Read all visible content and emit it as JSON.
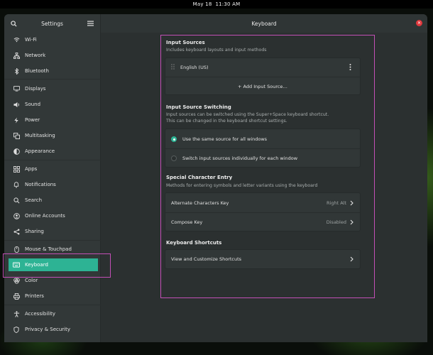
{
  "topbar": {
    "date": "May 18",
    "time": "11:30 AM"
  },
  "window": {
    "sidebar_title": "Settings",
    "title": "Keyboard"
  },
  "sidebar": {
    "items": [
      {
        "label": "Wi-Fi",
        "icon": "wifi-icon"
      },
      {
        "label": "Network",
        "icon": "network-icon"
      },
      {
        "label": "Bluetooth",
        "icon": "bluetooth-icon"
      },
      {
        "label": "Displays",
        "icon": "display-icon"
      },
      {
        "label": "Sound",
        "icon": "sound-icon"
      },
      {
        "label": "Power",
        "icon": "power-icon"
      },
      {
        "label": "Multitasking",
        "icon": "multitasking-icon"
      },
      {
        "label": "Appearance",
        "icon": "appearance-icon"
      },
      {
        "label": "Apps",
        "icon": "apps-icon"
      },
      {
        "label": "Notifications",
        "icon": "bell-icon"
      },
      {
        "label": "Search",
        "icon": "search-icon"
      },
      {
        "label": "Online Accounts",
        "icon": "online-accounts-icon"
      },
      {
        "label": "Sharing",
        "icon": "share-icon"
      },
      {
        "label": "Mouse & Touchpad",
        "icon": "mouse-icon"
      },
      {
        "label": "Keyboard",
        "icon": "keyboard-icon",
        "active": true
      },
      {
        "label": "Color",
        "icon": "color-icon"
      },
      {
        "label": "Printers",
        "icon": "printer-icon"
      },
      {
        "label": "Accessibility",
        "icon": "accessibility-icon"
      },
      {
        "label": "Privacy & Security",
        "icon": "privacy-icon"
      }
    ]
  },
  "input_sources": {
    "title": "Input Sources",
    "subtitle": "Includes keyboard layouts and input methods",
    "sources": [
      "English (US)"
    ],
    "add_label": "+ Add Input Source…"
  },
  "switching": {
    "title": "Input Source Switching",
    "subtitle_1": "Input sources can be switched using the Super+Space keyboard shortcut.",
    "subtitle_2": "This can be changed in the keyboard shortcut settings.",
    "options": [
      {
        "label": "Use the same source for all windows",
        "selected": true
      },
      {
        "label": "Switch input sources individually for each window",
        "selected": false
      }
    ]
  },
  "special_chars": {
    "title": "Special Character Entry",
    "subtitle": "Methods for entering symbols and letter variants using the keyboard",
    "rows": [
      {
        "label": "Alternate Characters Key",
        "value": "Right Alt"
      },
      {
        "label": "Compose Key",
        "value": "Disabled"
      }
    ]
  },
  "shortcuts": {
    "title": "Keyboard Shortcuts",
    "row_label": "View and Customize Shortcuts"
  },
  "colors": {
    "accent": "#2db394",
    "highlight": "#c34fb6",
    "close": "#e0383d"
  }
}
